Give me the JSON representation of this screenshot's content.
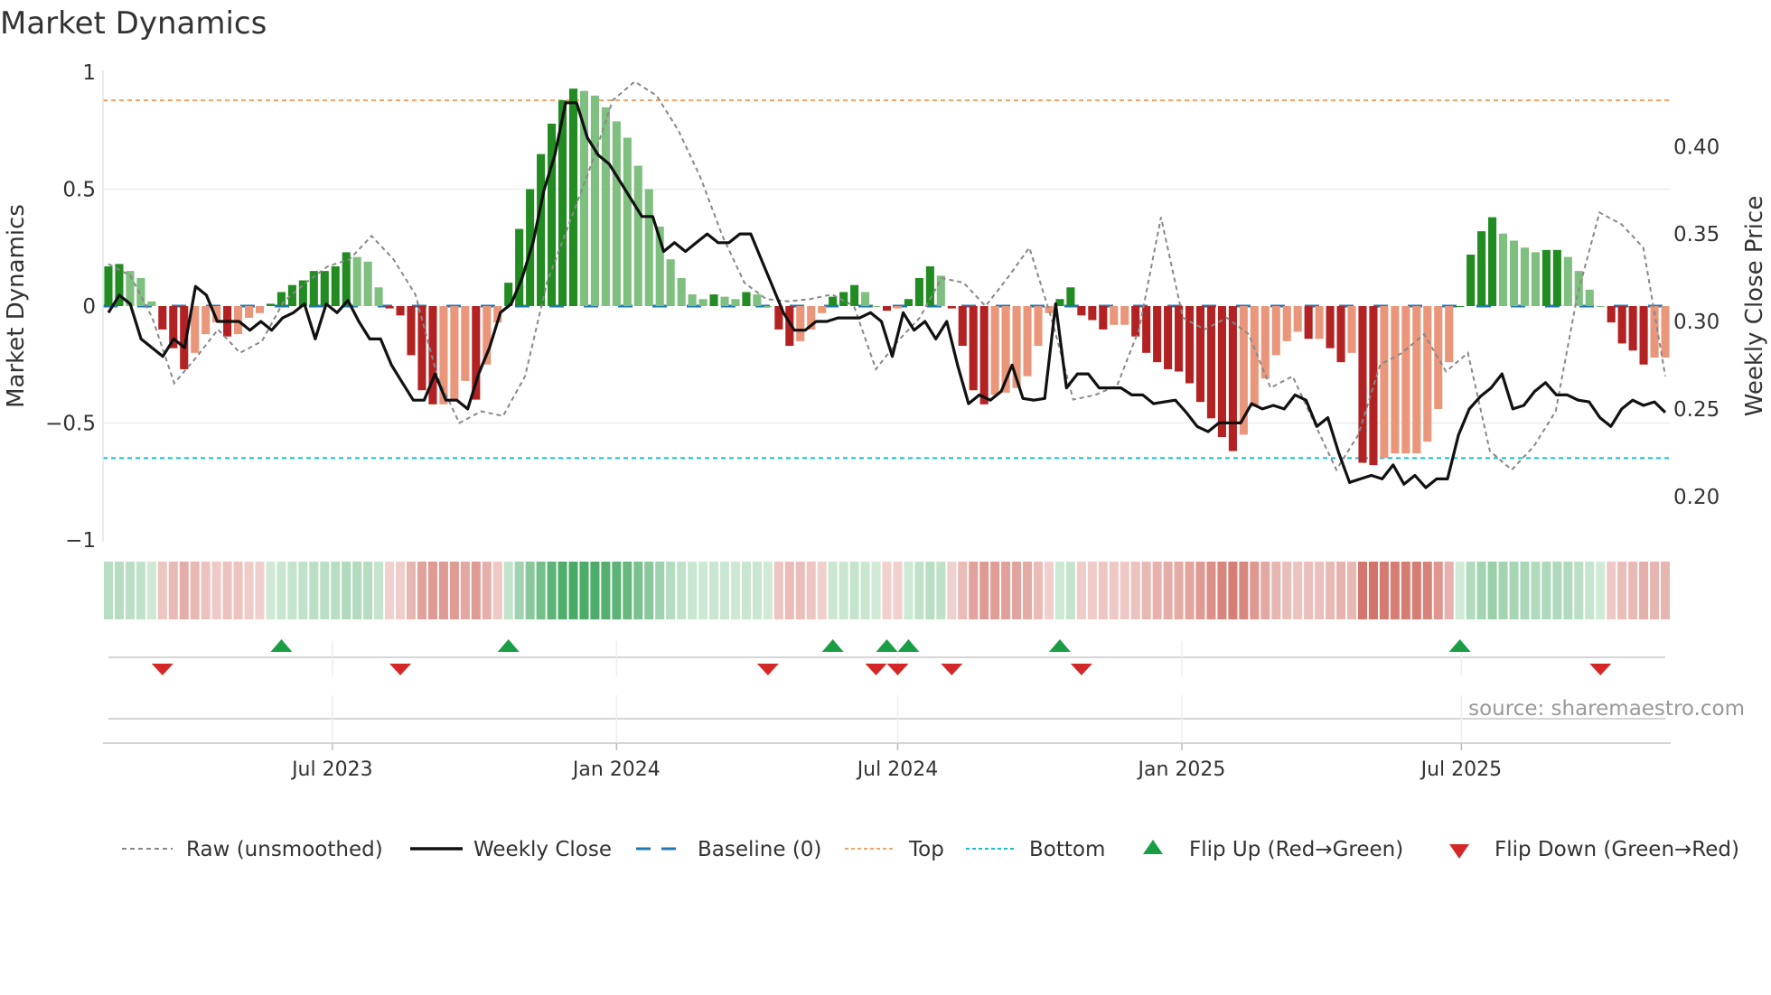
{
  "chart_data": {
    "type": "bar",
    "title": "Market Dynamics",
    "ylabel_left": "Market Dynamics",
    "ylabel_right": "Weekly Close Price",
    "ylim_left": [
      -1,
      1
    ],
    "ylim_right_ticks": [
      "0.40",
      "0.35",
      "0.30",
      "0.25",
      "0.20"
    ],
    "yticks_left": [
      {
        "v": 1,
        "label": "1"
      },
      {
        "v": 0.5,
        "label": "0.5"
      },
      {
        "v": 0,
        "label": "0"
      },
      {
        "v": -0.5,
        "label": "−0.5"
      },
      {
        "v": -1,
        "label": "−1"
      }
    ],
    "yticks_right": [
      0.4,
      0.35,
      0.3,
      0.25,
      0.2
    ],
    "start_date": "2023-02-06",
    "frequency": "weekly",
    "xticks": [
      {
        "date": "2023-07-01",
        "label": "Jul 2023"
      },
      {
        "date": "2024-01-01",
        "label": "Jan 2024"
      },
      {
        "date": "2024-07-01",
        "label": "Jul 2024"
      },
      {
        "date": "2025-01-01",
        "label": "Jan 2025"
      },
      {
        "date": "2025-07-01",
        "label": "Jul 2025"
      }
    ],
    "top_level": 0.88,
    "bottom_level": -0.65,
    "baseline": 0,
    "dynamics": [
      0.17,
      0.18,
      0.15,
      0.12,
      0.02,
      -0.1,
      -0.18,
      -0.27,
      -0.2,
      -0.12,
      -0.07,
      -0.13,
      -0.12,
      -0.05,
      -0.03,
      0.01,
      0.06,
      0.09,
      0.11,
      0.15,
      0.15,
      0.17,
      0.23,
      0.21,
      0.19,
      0.08,
      -0.01,
      -0.04,
      -0.21,
      -0.36,
      -0.42,
      -0.42,
      -0.4,
      -0.32,
      -0.4,
      -0.25,
      -0.07,
      0.1,
      0.33,
      0.5,
      0.65,
      0.78,
      0.88,
      0.93,
      0.92,
      0.9,
      0.85,
      0.79,
      0.72,
      0.6,
      0.5,
      0.34,
      0.2,
      0.12,
      0.05,
      0.03,
      0.05,
      0.04,
      0.03,
      0.06,
      0.05,
      0.0,
      -0.1,
      -0.17,
      -0.15,
      -0.1,
      -0.03,
      0.04,
      0.06,
      0.09,
      0.06,
      0.0,
      -0.02,
      -0.01,
      0.03,
      0.12,
      0.17,
      0.13,
      -0.01,
      -0.17,
      -0.36,
      -0.42,
      -0.38,
      -0.37,
      -0.35,
      -0.3,
      -0.17,
      -0.03,
      0.03,
      0.08,
      -0.04,
      -0.06,
      -0.1,
      -0.08,
      -0.08,
      -0.13,
      -0.2,
      -0.24,
      -0.27,
      -0.28,
      -0.33,
      -0.41,
      -0.48,
      -0.56,
      -0.62,
      -0.55,
      -0.43,
      -0.31,
      -0.21,
      -0.15,
      -0.11,
      -0.14,
      -0.14,
      -0.18,
      -0.24,
      -0.2,
      -0.67,
      -0.68,
      -0.65,
      -0.63,
      -0.63,
      -0.63,
      -0.58,
      -0.44,
      -0.24,
      0.0,
      0.22,
      0.32,
      0.38,
      0.31,
      0.28,
      0.25,
      0.23,
      0.24,
      0.24,
      0.21,
      0.15,
      0.07,
      0.0,
      -0.07,
      -0.16,
      -0.19,
      -0.25,
      -0.22,
      -0.22
    ],
    "raw_unsmoothed": [
      0.18,
      0.13,
      -0.05,
      -0.33,
      -0.22,
      -0.1,
      -0.2,
      -0.15,
      0.02,
      0.1,
      0.17,
      0.2,
      0.3,
      0.2,
      0.05,
      -0.3,
      -0.5,
      -0.45,
      -0.47,
      -0.3,
      0.1,
      0.35,
      0.6,
      0.88,
      0.96,
      0.9,
      0.75,
      0.55,
      0.3,
      0.1,
      0.03,
      0.02,
      0.03,
      0.05,
      0.0,
      -0.27,
      -0.15,
      -0.05,
      0.12,
      0.1,
      0.0,
      0.12,
      0.25,
      -0.05,
      -0.4,
      -0.38,
      -0.34,
      -0.1,
      0.38,
      -0.05,
      -0.1,
      -0.05,
      -0.12,
      -0.35,
      -0.3,
      -0.5,
      -0.7,
      -0.55,
      -0.25,
      -0.2,
      -0.12,
      -0.28,
      -0.2,
      -0.62,
      -0.7,
      -0.6,
      -0.45,
      0.05,
      0.4,
      0.35,
      0.25,
      -0.3
    ],
    "weekly_close": [
      0.305,
      0.315,
      0.31,
      0.29,
      0.285,
      0.28,
      0.29,
      0.285,
      0.32,
      0.315,
      0.3,
      0.3,
      0.3,
      0.295,
      0.3,
      0.295,
      0.302,
      0.305,
      0.31,
      0.29,
      0.31,
      0.305,
      0.312,
      0.3,
      0.29,
      0.29,
      0.275,
      0.265,
      0.255,
      0.255,
      0.27,
      0.255,
      0.255,
      0.25,
      0.27,
      0.285,
      0.305,
      0.31,
      0.325,
      0.345,
      0.375,
      0.395,
      0.425,
      0.425,
      0.405,
      0.395,
      0.39,
      0.38,
      0.37,
      0.36,
      0.36,
      0.34,
      0.345,
      0.34,
      0.345,
      0.35,
      0.345,
      0.345,
      0.35,
      0.35,
      0.335,
      0.32,
      0.305,
      0.295,
      0.295,
      0.3,
      0.3,
      0.302,
      0.302,
      0.302,
      0.305,
      0.3,
      0.28,
      0.305,
      0.295,
      0.3,
      0.29,
      0.3,
      0.275,
      0.253,
      0.258,
      0.255,
      0.26,
      0.275,
      0.256,
      0.255,
      0.256,
      0.31,
      0.262,
      0.27,
      0.27,
      0.262,
      0.262,
      0.262,
      0.258,
      0.258,
      0.253,
      0.254,
      0.255,
      0.248,
      0.24,
      0.237,
      0.242,
      0.242,
      0.242,
      0.253,
      0.25,
      0.252,
      0.25,
      0.258,
      0.255,
      0.24,
      0.245,
      0.225,
      0.208,
      0.21,
      0.212,
      0.21,
      0.218,
      0.207,
      0.212,
      0.205,
      0.21,
      0.21,
      0.235,
      0.25,
      0.257,
      0.262,
      0.27,
      0.25,
      0.252,
      0.26,
      0.265,
      0.258,
      0.258,
      0.255,
      0.254,
      0.245,
      0.24,
      0.25,
      0.255,
      0.252,
      0.254,
      0.248
    ],
    "flip_up_weeks": [
      16,
      37,
      67,
      72,
      74,
      88,
      125
    ],
    "flip_down_weeks": [
      5,
      27,
      61,
      71,
      73,
      78,
      90,
      138
    ],
    "legend": {
      "placement": "bottom",
      "items": [
        "Raw (unsmoothed)",
        "Weekly Close",
        "Baseline (0)",
        "Top",
        "Bottom",
        "Flip Up (Red→Green)",
        "Flip Down (Green→Red)"
      ]
    },
    "source": "source: sharemaestro.com"
  },
  "colors": {
    "dark_green": "#228b22",
    "light_green": "#7fbf7f",
    "dark_red": "#b22222",
    "light_red": "#e9967a",
    "top": "#f4a261",
    "bottom": "#17becf",
    "baseline": "#1f77b4",
    "flip_up": "#1a9e45",
    "flip_down": "#d62728"
  }
}
